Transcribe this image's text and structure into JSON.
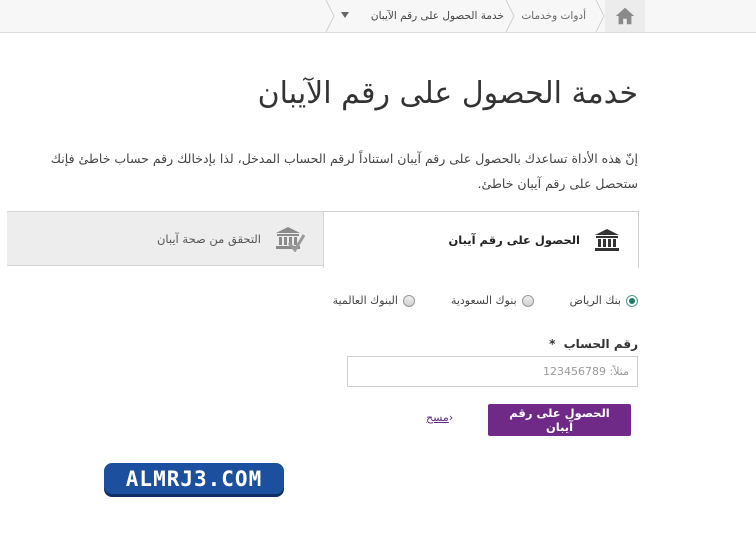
{
  "breadcrumb": {
    "tools": "أدوات وخدمات",
    "current": "خدمة الحصول على رقم الآيبان"
  },
  "page": {
    "title": "خدمة الحصول على رقم الآيبان",
    "intro": "إنّ هذه الأداة تساعدك بالحصول على رقم آيبان استناداً لرقم الحساب المدخل، لذا بإدخالك رقم حساب خاطئ فإنك ستحصل على رقم آيبان خاطئ."
  },
  "tabs": [
    {
      "label": "الحصول على رقم آيبان",
      "icon": "bank-icon",
      "active": true
    },
    {
      "label": "التحقق من صحة آيبان",
      "icon": "bank-check-icon",
      "active": false
    }
  ],
  "bank_options": [
    {
      "label": "بنك الرياض",
      "selected": true
    },
    {
      "label": "بنوك السعودية",
      "selected": false
    },
    {
      "label": "البنوك العالمية",
      "selected": false
    }
  ],
  "account_field": {
    "label": "رقم الحساب",
    "required_mark": "*",
    "placeholder": "مثلاً: 123456789",
    "value": ""
  },
  "actions": {
    "submit_label": "الحصول على رقم آيبان",
    "clear_label": "مسح",
    "clear_chevron": "‹"
  },
  "watermark": {
    "text": "ALMRJ3.COM"
  },
  "colors": {
    "accent": "#6e2a86",
    "radio_selected": "#1f7a6a",
    "watermark_bg": "#1c4f9e"
  }
}
